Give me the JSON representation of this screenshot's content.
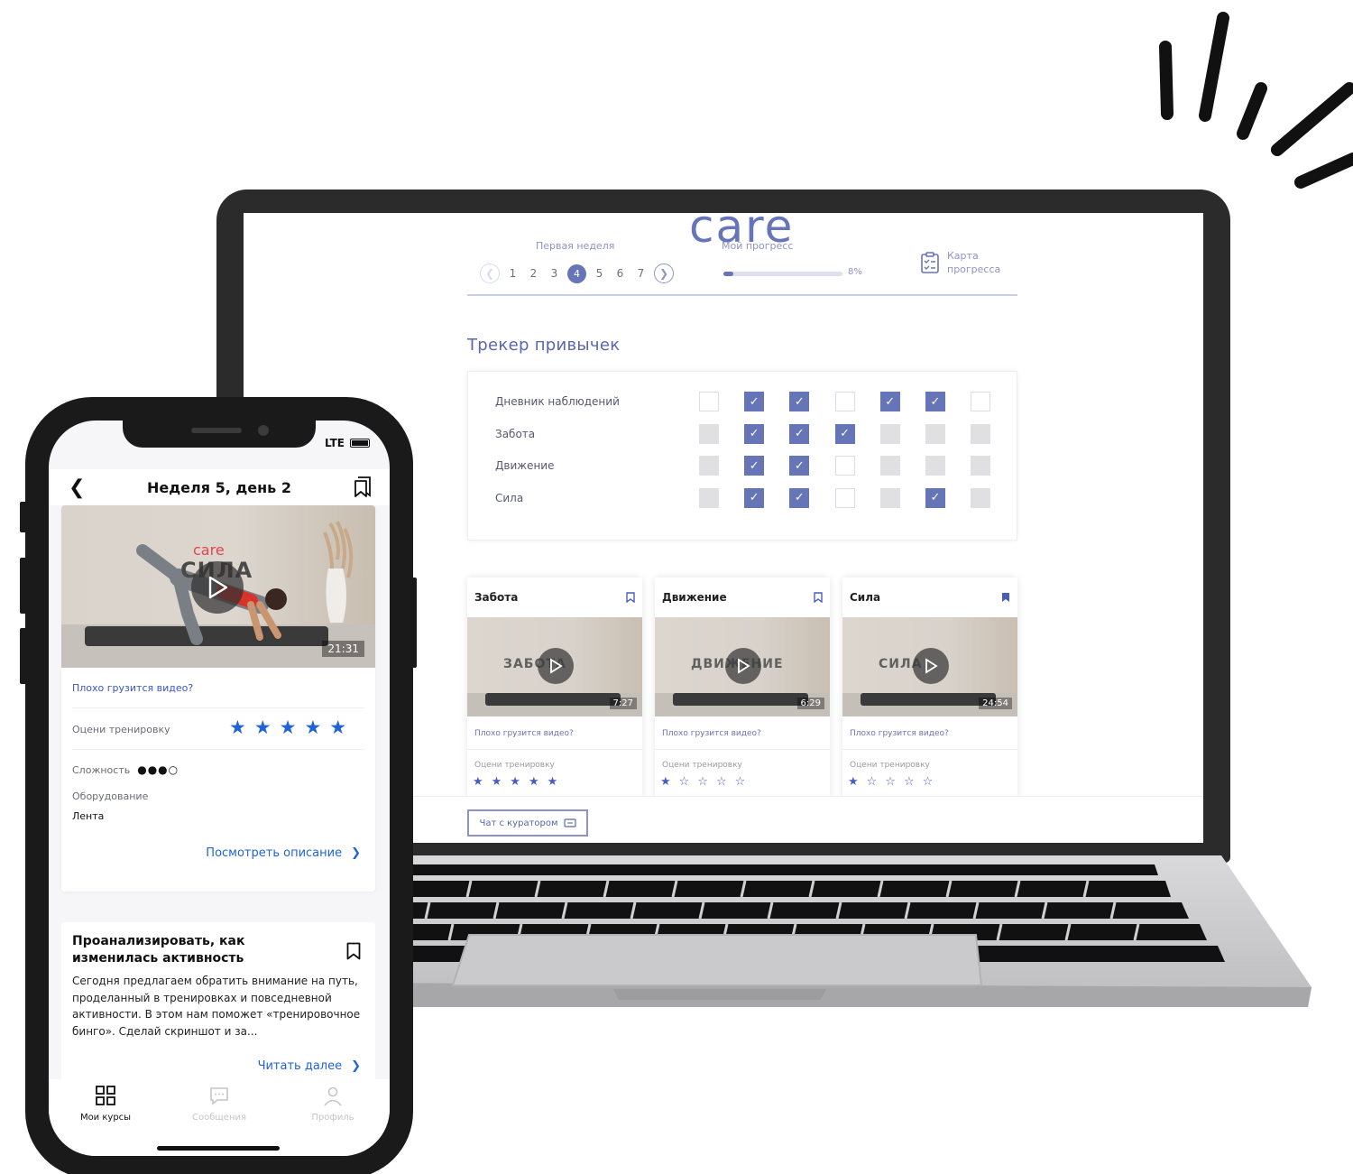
{
  "laptop": {
    "logo": "care",
    "progress": {
      "label": "Мой прогресс",
      "percent_text": "8%",
      "value": 8
    },
    "week": {
      "label": "Первая неделя",
      "days": [
        "1",
        "2",
        "3",
        "4",
        "5",
        "6",
        "7"
      ],
      "active_day": "4",
      "prev_icon": "chevron-left-icon",
      "next_icon": "chevron-right-icon"
    },
    "progress_map": {
      "label": "Карта прогресса",
      "icon": "clipboard-checklist-icon"
    },
    "habit_tracker": {
      "title": "Трекер привычек",
      "rows": [
        {
          "name": "Дневник наблюдений",
          "cells": [
            "empty",
            "on",
            "on",
            "empty",
            "on",
            "on",
            "empty"
          ]
        },
        {
          "name": "Забота",
          "cells": [
            "off",
            "on",
            "on",
            "on",
            "off",
            "off",
            "off"
          ]
        },
        {
          "name": "Движение",
          "cells": [
            "off",
            "on",
            "on",
            "empty",
            "off",
            "off",
            "off"
          ]
        },
        {
          "name": "Сила",
          "cells": [
            "off",
            "on",
            "on",
            "empty",
            "off",
            "on",
            "off"
          ]
        }
      ]
    },
    "cards": [
      {
        "title": "Забота",
        "video_word": "ЗАБОТА",
        "duration": "7:27",
        "bad_video": "Плохо грузится видео?",
        "rate_label": "Оцени тренировку",
        "stars": "★★★★★",
        "bookmarked": false
      },
      {
        "title": "Движение",
        "video_word": "ДВИЖЕНИЕ",
        "duration": "6:29",
        "bad_video": "Плохо грузится видео?",
        "rate_label": "Оцени тренировку",
        "stars": "★☆☆☆☆",
        "bookmarked": false
      },
      {
        "title": "Сила",
        "video_word": "СИЛА",
        "duration": "24:54",
        "bad_video": "Плохо грузится видео?",
        "rate_label": "Оцени тренировку",
        "stars": "★☆☆☆☆",
        "bookmarked": true
      }
    ],
    "chat_button": {
      "label": "Чат с куратором",
      "icon": "chat-icon"
    }
  },
  "phone": {
    "status": {
      "network": "LTE"
    },
    "header": {
      "title": "Неделя 5, день 2",
      "back_icon": "chevron-left-icon",
      "bookmark_icon": "bookmarks-icon"
    },
    "video": {
      "logo": "care",
      "word": "СИЛА",
      "duration": "21:31"
    },
    "bad_video": "Плохо грузится видео?",
    "rate_label": "Оцени тренировку",
    "stars": "★★★★★",
    "difficulty": {
      "label": "Сложность",
      "dots": "●●●○",
      "level": 3,
      "max": 4
    },
    "equipment": {
      "label": "Оборудование",
      "value": "Лента"
    },
    "description_link": "Посмотреть описание",
    "task": {
      "title": "Проанализировать, как изменилась активность",
      "text": "Сегодня предлагаем обратить внимание на путь, проделанный в тренировках и повседневной активности. В этом нам поможет «тренировочное бинго». Сделай скриншот и за...",
      "link": "Читать далее"
    },
    "tabs": [
      {
        "label": "Мои курсы",
        "icon": "grid-icon",
        "active": true
      },
      {
        "label": "Сообщения",
        "icon": "chat-bubble-icon",
        "active": false
      },
      {
        "label": "Профиль",
        "icon": "person-icon",
        "active": false
      }
    ]
  },
  "colors": {
    "accent": "#6674b8",
    "phone_accent": "#1f64d6"
  }
}
